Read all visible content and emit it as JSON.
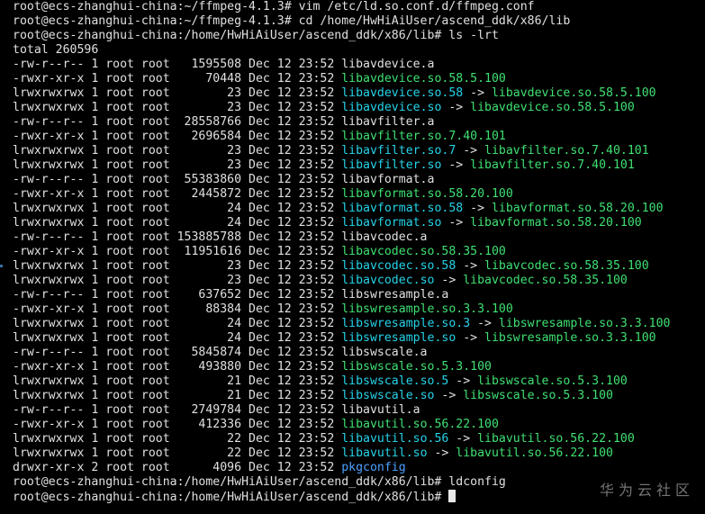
{
  "terminal": {
    "lines": [
      [
        {
          "t": "root@ecs-zhanghui-china:~/ffmpeg-4.1.3# vim /etc/ld.so.conf.d/ffmpeg.conf",
          "c": "plain"
        }
      ],
      [
        {
          "t": "root@ecs-zhanghui-china:~/ffmpeg-4.1.3# cd /home/HwHiAiUser/ascend_ddk/x86/lib",
          "c": "plain"
        }
      ],
      [
        {
          "t": "root@ecs-zhanghui-china:/home/HwHiAiUser/ascend_ddk/x86/lib# ls -lrt",
          "c": "plain"
        }
      ],
      [
        {
          "t": "total 260596",
          "c": "plain"
        }
      ],
      [
        {
          "t": "-rw-r--r-- 1 root root   1595508 Dec 12 23:52 libavdevice.a",
          "c": "plain"
        }
      ],
      [
        {
          "t": "-rwxr-xr-x 1 root root     70448 Dec 12 23:52 ",
          "c": "plain"
        },
        {
          "t": "libavdevice.so.58.5.100",
          "c": "green"
        }
      ],
      [
        {
          "t": "lrwxrwxrwx 1 root root        23 Dec 12 23:52 ",
          "c": "plain"
        },
        {
          "t": "libavdevice.so.58",
          "c": "cyan"
        },
        {
          "t": " -> ",
          "c": "plain"
        },
        {
          "t": "libavdevice.so.58.5.100",
          "c": "green"
        }
      ],
      [
        {
          "t": "lrwxrwxrwx 1 root root        23 Dec 12 23:52 ",
          "c": "plain"
        },
        {
          "t": "libavdevice.so",
          "c": "cyan"
        },
        {
          "t": " -> ",
          "c": "plain"
        },
        {
          "t": "libavdevice.so.58.5.100",
          "c": "green"
        }
      ],
      [
        {
          "t": "-rw-r--r-- 1 root root  28558766 Dec 12 23:52 libavfilter.a",
          "c": "plain"
        }
      ],
      [
        {
          "t": "-rwxr-xr-x 1 root root   2696584 Dec 12 23:52 ",
          "c": "plain"
        },
        {
          "t": "libavfilter.so.7.40.101",
          "c": "green"
        }
      ],
      [
        {
          "t": "lrwxrwxrwx 1 root root        23 Dec 12 23:52 ",
          "c": "plain"
        },
        {
          "t": "libavfilter.so.7",
          "c": "cyan"
        },
        {
          "t": " -> ",
          "c": "plain"
        },
        {
          "t": "libavfilter.so.7.40.101",
          "c": "green"
        }
      ],
      [
        {
          "t": "lrwxrwxrwx 1 root root        23 Dec 12 23:52 ",
          "c": "plain"
        },
        {
          "t": "libavfilter.so",
          "c": "cyan"
        },
        {
          "t": " -> ",
          "c": "plain"
        },
        {
          "t": "libavfilter.so.7.40.101",
          "c": "green"
        }
      ],
      [
        {
          "t": "-rw-r--r-- 1 root root  55383860 Dec 12 23:52 libavformat.a",
          "c": "plain"
        }
      ],
      [
        {
          "t": "-rwxr-xr-x 1 root root   2445872 Dec 12 23:52 ",
          "c": "plain"
        },
        {
          "t": "libavformat.so.58.20.100",
          "c": "green"
        }
      ],
      [
        {
          "t": "lrwxrwxrwx 1 root root        24 Dec 12 23:52 ",
          "c": "plain"
        },
        {
          "t": "libavformat.so.58",
          "c": "cyan"
        },
        {
          "t": " -> ",
          "c": "plain"
        },
        {
          "t": "libavformat.so.58.20.100",
          "c": "green"
        }
      ],
      [
        {
          "t": "lrwxrwxrwx 1 root root        24 Dec 12 23:52 ",
          "c": "plain"
        },
        {
          "t": "libavformat.so",
          "c": "cyan"
        },
        {
          "t": " -> ",
          "c": "plain"
        },
        {
          "t": "libavformat.so.58.20.100",
          "c": "green"
        }
      ],
      [
        {
          "t": "-rw-r--r-- 1 root root 153885788 Dec 12 23:52 libavcodec.a",
          "c": "plain"
        }
      ],
      [
        {
          "t": "-rwxr-xr-x 1 root root  11951616 Dec 12 23:52 ",
          "c": "plain"
        },
        {
          "t": "libavcodec.so.58.35.100",
          "c": "green"
        }
      ],
      [
        {
          "t": "lrwxrwxrwx 1 root root        23 Dec 12 23:52 ",
          "c": "plain"
        },
        {
          "t": "libavcodec.so.58",
          "c": "cyan"
        },
        {
          "t": " -> ",
          "c": "plain"
        },
        {
          "t": "libavcodec.so.58.35.100",
          "c": "green"
        }
      ],
      [
        {
          "t": "lrwxrwxrwx 1 root root        23 Dec 12 23:52 ",
          "c": "plain"
        },
        {
          "t": "libavcodec.so",
          "c": "cyan"
        },
        {
          "t": " -> ",
          "c": "plain"
        },
        {
          "t": "libavcodec.so.58.35.100",
          "c": "green"
        }
      ],
      [
        {
          "t": "-rw-r--r-- 1 root root    637652 Dec 12 23:52 libswresample.a",
          "c": "plain"
        }
      ],
      [
        {
          "t": "-rwxr-xr-x 1 root root     88384 Dec 12 23:52 ",
          "c": "plain"
        },
        {
          "t": "libswresample.so.3.3.100",
          "c": "green"
        }
      ],
      [
        {
          "t": "lrwxrwxrwx 1 root root        24 Dec 12 23:52 ",
          "c": "plain"
        },
        {
          "t": "libswresample.so.3",
          "c": "cyan"
        },
        {
          "t": " -> ",
          "c": "plain"
        },
        {
          "t": "libswresample.so.3.3.100",
          "c": "green"
        }
      ],
      [
        {
          "t": "lrwxrwxrwx 1 root root        24 Dec 12 23:52 ",
          "c": "plain"
        },
        {
          "t": "libswresample.so",
          "c": "cyan"
        },
        {
          "t": " -> ",
          "c": "plain"
        },
        {
          "t": "libswresample.so.3.3.100",
          "c": "green"
        }
      ],
      [
        {
          "t": "-rw-r--r-- 1 root root   5845874 Dec 12 23:52 libswscale.a",
          "c": "plain"
        }
      ],
      [
        {
          "t": "-rwxr-xr-x 1 root root    493880 Dec 12 23:52 ",
          "c": "plain"
        },
        {
          "t": "libswscale.so.5.3.100",
          "c": "green"
        }
      ],
      [
        {
          "t": "lrwxrwxrwx 1 root root        21 Dec 12 23:52 ",
          "c": "plain"
        },
        {
          "t": "libswscale.so.5",
          "c": "cyan"
        },
        {
          "t": " -> ",
          "c": "plain"
        },
        {
          "t": "libswscale.so.5.3.100",
          "c": "green"
        }
      ],
      [
        {
          "t": "lrwxrwxrwx 1 root root        21 Dec 12 23:52 ",
          "c": "plain"
        },
        {
          "t": "libswscale.so",
          "c": "cyan"
        },
        {
          "t": " -> ",
          "c": "plain"
        },
        {
          "t": "libswscale.so.5.3.100",
          "c": "green"
        }
      ],
      [
        {
          "t": "-rw-r--r-- 1 root root   2749784 Dec 12 23:52 libavutil.a",
          "c": "plain"
        }
      ],
      [
        {
          "t": "-rwxr-xr-x 1 root root    412336 Dec 12 23:52 ",
          "c": "plain"
        },
        {
          "t": "libavutil.so.56.22.100",
          "c": "green"
        }
      ],
      [
        {
          "t": "lrwxrwxrwx 1 root root        22 Dec 12 23:52 ",
          "c": "plain"
        },
        {
          "t": "libavutil.so.56",
          "c": "cyan"
        },
        {
          "t": " -> ",
          "c": "plain"
        },
        {
          "t": "libavutil.so.56.22.100",
          "c": "green"
        }
      ],
      [
        {
          "t": "lrwxrwxrwx 1 root root        22 Dec 12 23:52 ",
          "c": "plain"
        },
        {
          "t": "libavutil.so",
          "c": "cyan"
        },
        {
          "t": " -> ",
          "c": "plain"
        },
        {
          "t": "libavutil.so.56.22.100",
          "c": "green"
        }
      ],
      [
        {
          "t": "drwxr-xr-x 2 root root      4096 Dec 12 23:52 ",
          "c": "plain"
        },
        {
          "t": "pkgconfig",
          "c": "blue"
        }
      ],
      [
        {
          "t": "root@ecs-zhanghui-china:/home/HwHiAiUser/ascend_ddk/x86/lib# ldconfig",
          "c": "plain"
        }
      ],
      [
        {
          "t": "root@ecs-zhanghui-china:/home/HwHiAiUser/ascend_ddk/x86/lib# ",
          "c": "plain"
        }
      ]
    ],
    "colors": {
      "background": "#000000",
      "text": "#e0e0e0",
      "executable": "#3fe072",
      "symlink": "#25d3e8",
      "directory": "#4aa2ff"
    }
  },
  "watermark": {
    "text": "华为云社区"
  }
}
